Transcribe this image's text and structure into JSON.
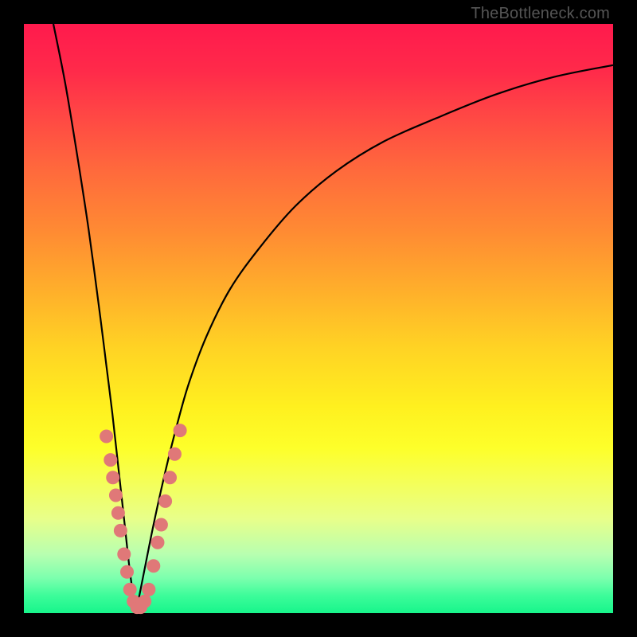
{
  "watermark_text": "TheBottleneck.com",
  "colors": {
    "background": "#000000",
    "curve": "#000000",
    "dots": "#e07878",
    "gradient_top": "#ff1a4d",
    "gradient_bottom": "#17f58b"
  },
  "chart_data": {
    "type": "line",
    "title": "",
    "xlabel": "",
    "ylabel": "",
    "xlim": [
      0,
      100
    ],
    "ylim": [
      0,
      100
    ],
    "grid": false,
    "legend": null,
    "description": "V-shaped bottleneck curve. Y value represents bottleneck severity (0 = no bottleneck, 100 = severe). Left branch falls steeply from top-left corner to a minimum near x≈19, right branch rises with decreasing slope toward the upper right. Background gradient red→yellow→green corresponds to high→low bottleneck.",
    "series": [
      {
        "name": "left-branch",
        "x": [
          5,
          7,
          9,
          11,
          13,
          14,
          15,
          16,
          17,
          18,
          19
        ],
        "y": [
          100,
          90,
          78,
          65,
          50,
          42,
          34,
          25,
          16,
          7,
          0
        ]
      },
      {
        "name": "right-branch",
        "x": [
          19,
          20,
          22,
          24,
          26,
          28,
          31,
          35,
          40,
          46,
          53,
          61,
          70,
          80,
          90,
          100
        ],
        "y": [
          0,
          5,
          15,
          24,
          32,
          39,
          47,
          55,
          62,
          69,
          75,
          80,
          84,
          88,
          91,
          93
        ]
      }
    ],
    "highlighted_points": {
      "note": "Salmon-colored sample dots clustered on both branches near the valley",
      "points": [
        {
          "x": 14.0,
          "y": 30
        },
        {
          "x": 14.7,
          "y": 26
        },
        {
          "x": 15.1,
          "y": 23
        },
        {
          "x": 15.6,
          "y": 20
        },
        {
          "x": 16.0,
          "y": 17
        },
        {
          "x": 16.4,
          "y": 14
        },
        {
          "x": 17.0,
          "y": 10
        },
        {
          "x": 17.5,
          "y": 7
        },
        {
          "x": 18.0,
          "y": 4
        },
        {
          "x": 18.6,
          "y": 2
        },
        {
          "x": 19.2,
          "y": 1
        },
        {
          "x": 19.8,
          "y": 1
        },
        {
          "x": 20.5,
          "y": 2
        },
        {
          "x": 21.2,
          "y": 4
        },
        {
          "x": 22.0,
          "y": 8
        },
        {
          "x": 22.7,
          "y": 12
        },
        {
          "x": 23.3,
          "y": 15
        },
        {
          "x": 24.0,
          "y": 19
        },
        {
          "x": 24.8,
          "y": 23
        },
        {
          "x": 25.6,
          "y": 27
        },
        {
          "x": 26.5,
          "y": 31
        }
      ]
    }
  }
}
